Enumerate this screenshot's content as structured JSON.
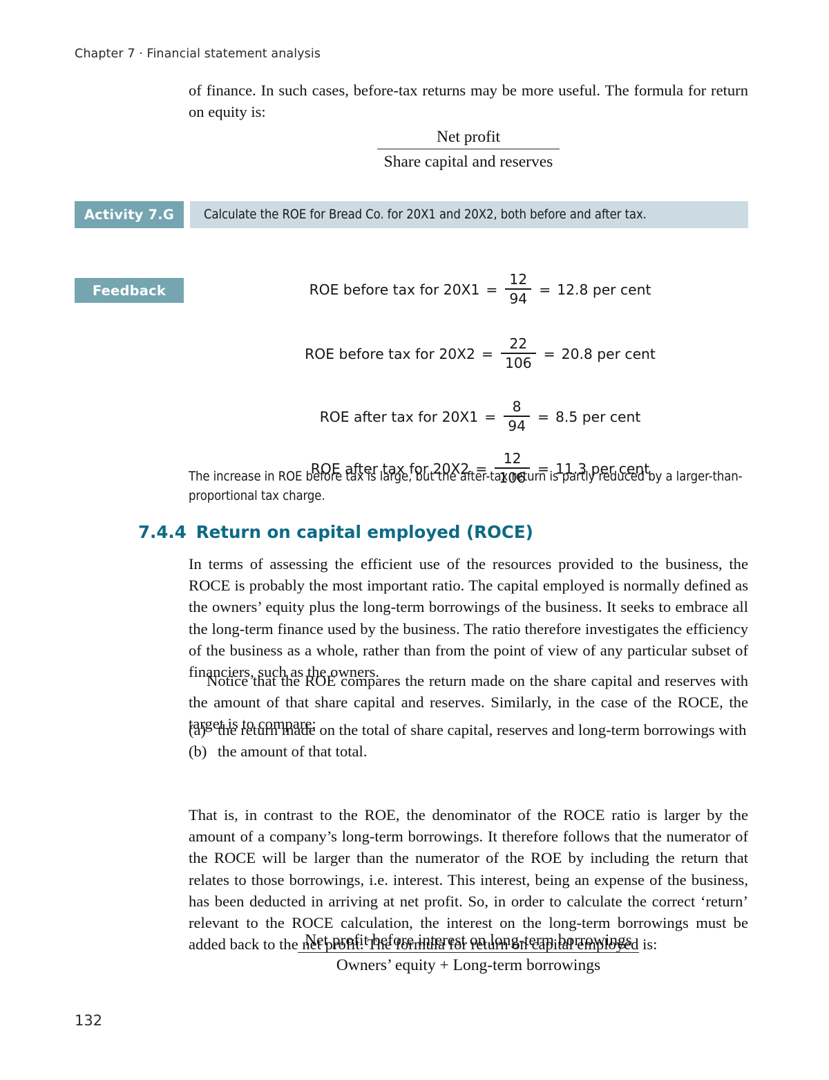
{
  "page": {
    "running_head": "Chapter 7 · Financial statement analysis",
    "folio": "132"
  },
  "intro_paragraph": "of finance. In such cases, before-tax returns may be more useful. The formula for return on equity is:",
  "roe_formula": {
    "numerator": "Net profit",
    "denominator": "Share capital and reserves"
  },
  "activity": {
    "label": "Activity 7.G",
    "text": "Calculate the ROE for Bread Co. for 20X1 and 20X2, both before and after tax.",
    "label_bg": "#74a5b0",
    "body_bg": "#ccdbe1"
  },
  "feedback": {
    "label": "Feedback",
    "equations": [
      {
        "label": "ROE before tax for 20X1",
        "eq1": "=",
        "numerator": "12",
        "denominator": "94",
        "eq2": "=",
        "result": "12.8 per cent"
      },
      {
        "label": "ROE before tax for 20X2",
        "eq1": "=",
        "numerator": "22",
        "denominator": "106",
        "eq2": "=",
        "result": "20.8 per cent"
      },
      {
        "label": "ROE after tax for 20X1",
        "eq1": "=",
        "numerator": "8",
        "denominator": "94",
        "eq2": "=",
        "result": "8.5 per cent"
      },
      {
        "label": "ROE after tax for 20X2",
        "eq1": "=",
        "numerator": "12",
        "denominator": "106",
        "eq2": "=",
        "result": "11.3 per cent"
      }
    ],
    "note": "The increase in ROE before tax is large, but the after-tax return is partly reduced by a larger-than-proportional tax charge."
  },
  "section": {
    "number": "7.4.4",
    "title": "Return on capital employed (ROCE)",
    "color": "#0d6a85"
  },
  "paragraphs": {
    "p1": "In terms of assessing the efficient use of the resources provided to the business, the ROCE is probably the most important ratio. The capital employed is normally defined as the owners’ equity plus the long-term borrowings of the business. It seeks to embrace all the long-term finance used by the business. The ratio therefore investigates the efficiency of the business as a whole, rather than from the point of view of any particular subset of financiers, such as the owners.",
    "p2": "Notice that the ROE compares the return made on the share capital and reserves with the amount of that share capital and reserves. Similarly, in the case of the ROCE, the target is to compare:",
    "p3": "That is, in contrast to the ROE, the denominator of the ROCE ratio is larger by the amount of a company’s long-term borrowings. It therefore follows that the numerator of the ROCE will be larger than the numerator of the ROE by including the return that relates to those borrowings, i.e. interest. This interest, being an expense of the business, has been deducted in arriving at net profit. So, in order to calculate the correct ‘return’ relevant to the ROCE calculation, the interest on the long-term borrowings must be added back to the net profit. The formula for return on capital employed is:"
  },
  "compare_list": [
    {
      "marker": "(a)",
      "text": "the return made on the total of share capital, reserves and long-term borrowings with"
    },
    {
      "marker": "(b)",
      "text": "the amount of that total."
    }
  ],
  "roce_formula": {
    "numerator": "Net profit before interest on long-term borrowings",
    "denominator": "Owners’ equity + Long-term borrowings"
  }
}
